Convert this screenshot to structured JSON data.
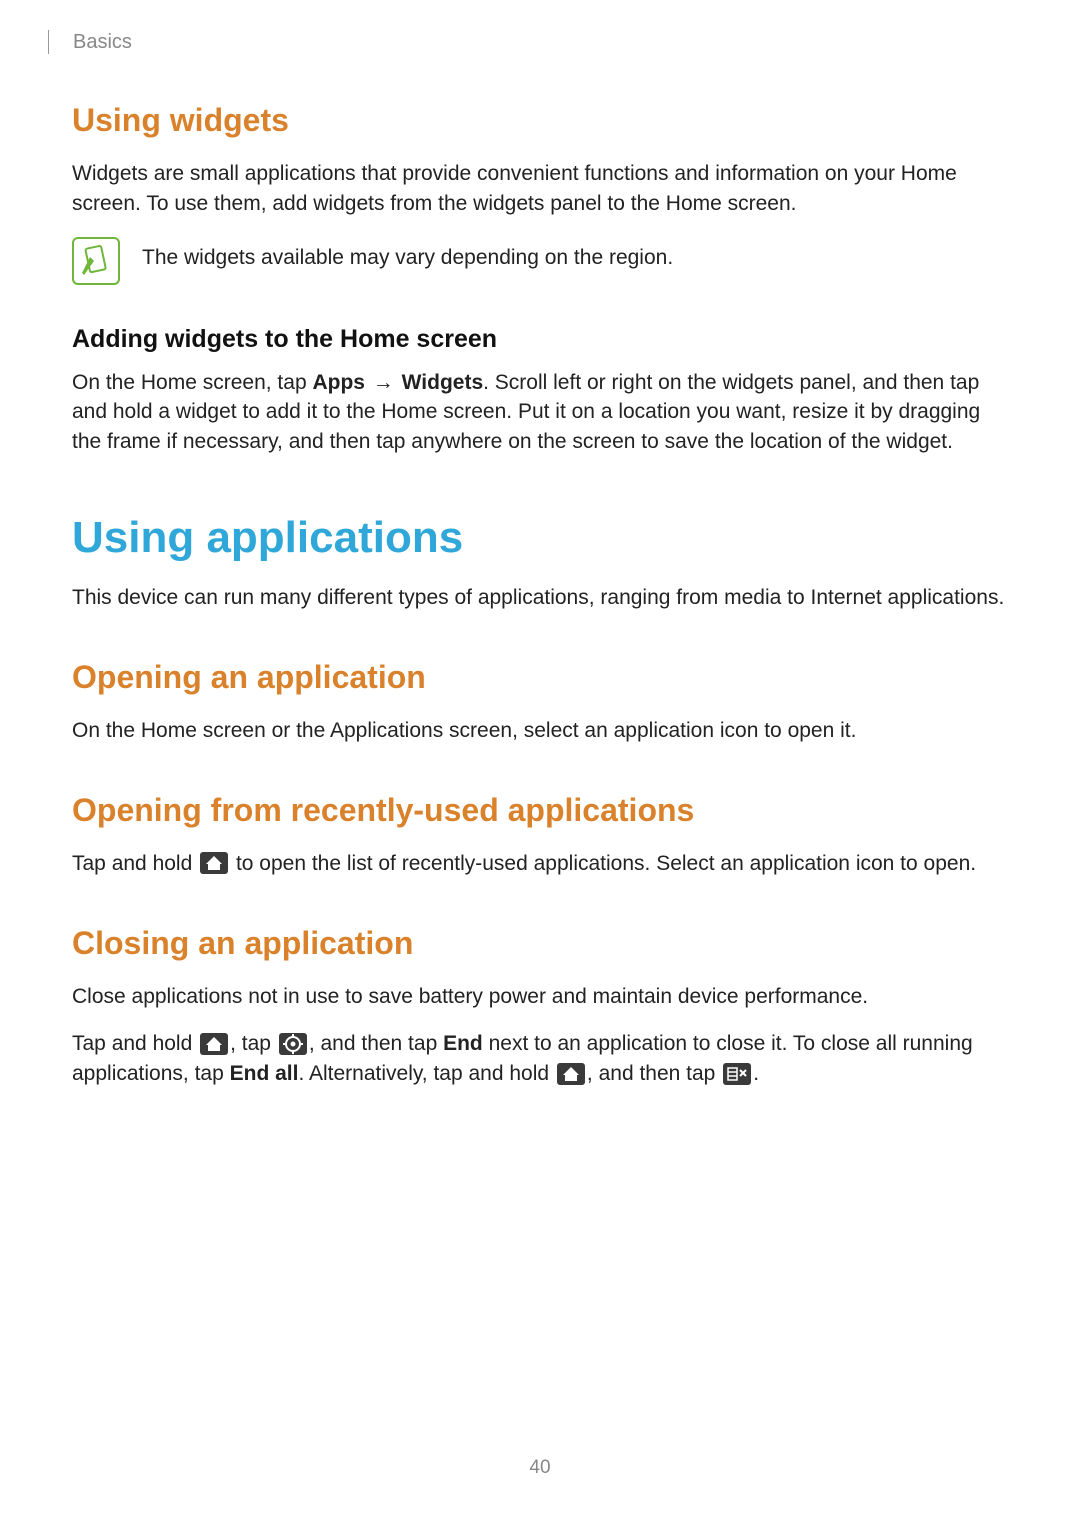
{
  "running_head": "Basics",
  "sec1": {
    "heading": "Using widgets",
    "p1": "Widgets are small applications that provide convenient functions and information on your Home screen. To use them, add widgets from the widgets panel to the Home screen.",
    "note": "The widgets available may vary depending on the region."
  },
  "sub1": {
    "heading": "Adding widgets to the Home screen",
    "p_pre": "On the Home screen, tap ",
    "bold_apps": "Apps",
    "arrow": " → ",
    "bold_widgets": "Widgets",
    "p_post": ". Scroll left or right on the widgets panel, and then tap and hold a widget to add it to the Home screen. Put it on a location you want, resize it by dragging the frame if necessary, and then tap anywhere on the screen to save the location of the widget."
  },
  "chapter": {
    "heading": "Using applications",
    "intro": "This device can run many different types of applications, ranging from media to Internet applications."
  },
  "sec2": {
    "heading": "Opening an application",
    "p1": "On the Home screen or the Applications screen, select an application icon to open it."
  },
  "sec3": {
    "heading": "Opening from recently-used applications",
    "p_pre": "Tap and hold ",
    "p_post": " to open the list of recently-used applications. Select an application icon to open."
  },
  "sec4": {
    "heading": "Closing an application",
    "intro": "Close applications not in use to save battery power and maintain device performance.",
    "p2_a": "Tap and hold ",
    "p2_b": ", tap ",
    "p2_c": ", and then tap ",
    "p2_end_bold": "End",
    "p2_d": " next to an application to close it. To close all running applications, tap ",
    "p2_endall_bold": "End all",
    "p2_e": ". Alternatively, tap and hold ",
    "p2_f": ", and then tap ",
    "p2_g": "."
  },
  "page_number": "40"
}
